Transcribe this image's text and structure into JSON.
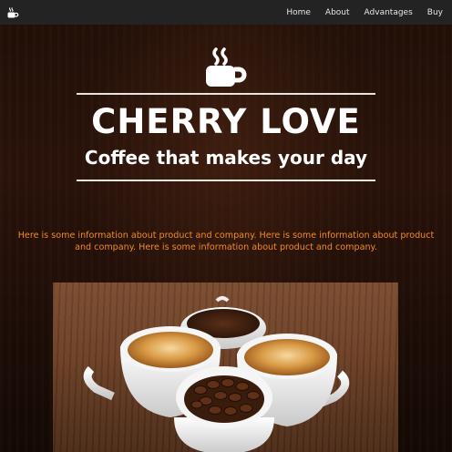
{
  "nav": {
    "logo_icon": "coffee-cup-icon",
    "links": [
      "Home",
      "About",
      "Advantages",
      "Buy"
    ]
  },
  "hero": {
    "icon": "coffee-cup-icon",
    "title": "CHERRY LOVE",
    "subtitle": "Coffee that makes your day",
    "info": "Here is some information about product and company. Here is some information about product and company. Here is some information about product and company."
  },
  "photo": {
    "subject": "coffee-cups-image"
  },
  "colors": {
    "nav_bg": "#232323",
    "accent": "#f08a24",
    "title": "#ffffff",
    "hero_bg": "#1c0d07"
  }
}
